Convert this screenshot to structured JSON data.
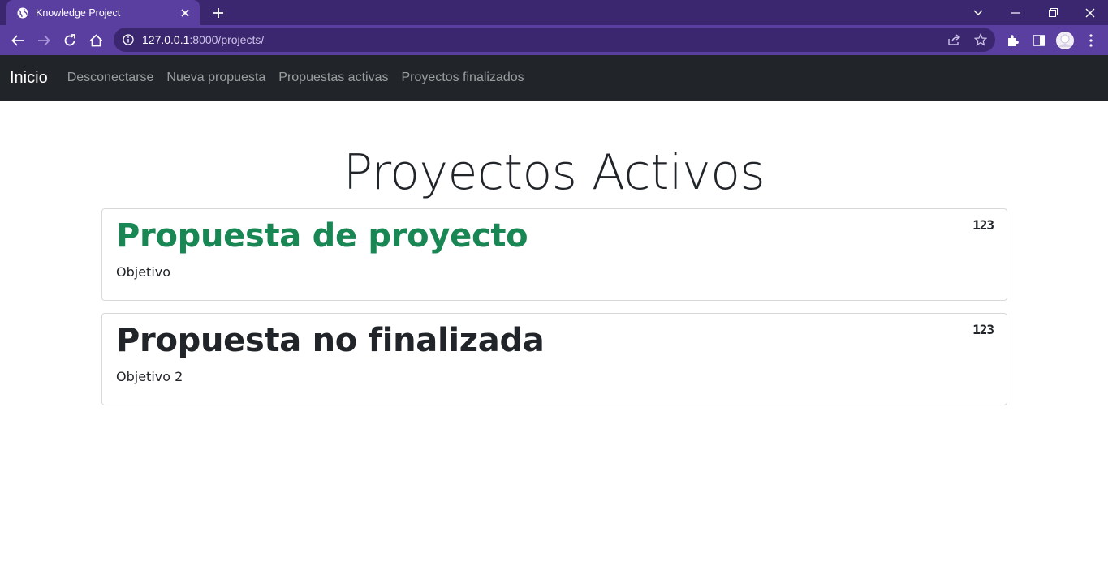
{
  "browser": {
    "tab_title": "Knowledge Project",
    "url_host": "127.0.0.1",
    "url_path": ":8000/projects/"
  },
  "navbar": {
    "brand": "Inicio",
    "links": [
      "Desconectarse",
      "Nueva propuesta",
      "Propuestas activas",
      "Proyectos finalizados"
    ]
  },
  "main": {
    "title": "Proyectos Activos",
    "projects": [
      {
        "title": "Propuesta de proyecto",
        "objective": "Objetivo",
        "badge": "123",
        "title_color": "#198754"
      },
      {
        "title": "Propuesta no finalizada",
        "objective": "Objetivo 2",
        "badge": "123",
        "title_color": "#212529"
      }
    ]
  },
  "colors": {
    "tabbar_bg": "#3b2770",
    "toolbar_bg": "#5a3ea0",
    "navbar_bg": "#212529",
    "accent_green": "#198754"
  }
}
